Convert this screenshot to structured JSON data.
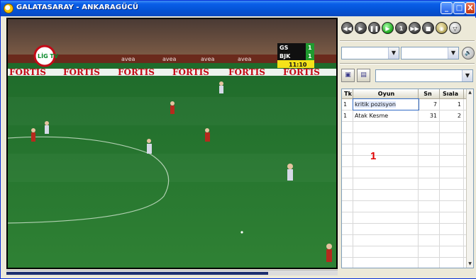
{
  "window": {
    "title": "GALATASARAY - ANKARAGÜCÜ",
    "buttons": [
      "_",
      "□",
      "X"
    ]
  },
  "video": {
    "overlay_logo": "LİG TV",
    "scoreboard": {
      "home_code": "GS",
      "home_score": "1",
      "away_code": "BJK",
      "away_score": "1",
      "clock": "11:10"
    },
    "boards": [
      "FORTIS",
      "FORTIS",
      "FORTIS",
      "FORTIS",
      "FORTIS",
      "FORTIS"
    ],
    "upper_boards": [
      "avea",
      "avea",
      "avea",
      "avea"
    ],
    "progress": 0.79
  },
  "controls": {
    "buttons": [
      {
        "name": "rewind",
        "glyph": "◀◀"
      },
      {
        "name": "play-back",
        "glyph": "▶"
      },
      {
        "name": "pause",
        "glyph": "❚❚"
      },
      {
        "name": "play",
        "glyph": "▶"
      },
      {
        "name": "step",
        "glyph": "1"
      },
      {
        "name": "fast-forward",
        "glyph": "▶▶"
      },
      {
        "name": "stop",
        "glyph": "■"
      },
      {
        "name": "record",
        "glyph": "◉"
      },
      {
        "name": "expand",
        "glyph": "▽"
      }
    ],
    "volume_glyph": "🔊"
  },
  "event_table": {
    "columns": [
      "Tk",
      "Oyun",
      "Sn",
      "Sıala"
    ],
    "rows": [
      {
        "tk": "1",
        "oyun": "kritik pozisyon",
        "sn": "7",
        "sira": "1"
      },
      {
        "tk": "1",
        "oyun": "Atak Kesme",
        "sn": "31",
        "sira": "2"
      }
    ],
    "annotation_marker": "1"
  }
}
